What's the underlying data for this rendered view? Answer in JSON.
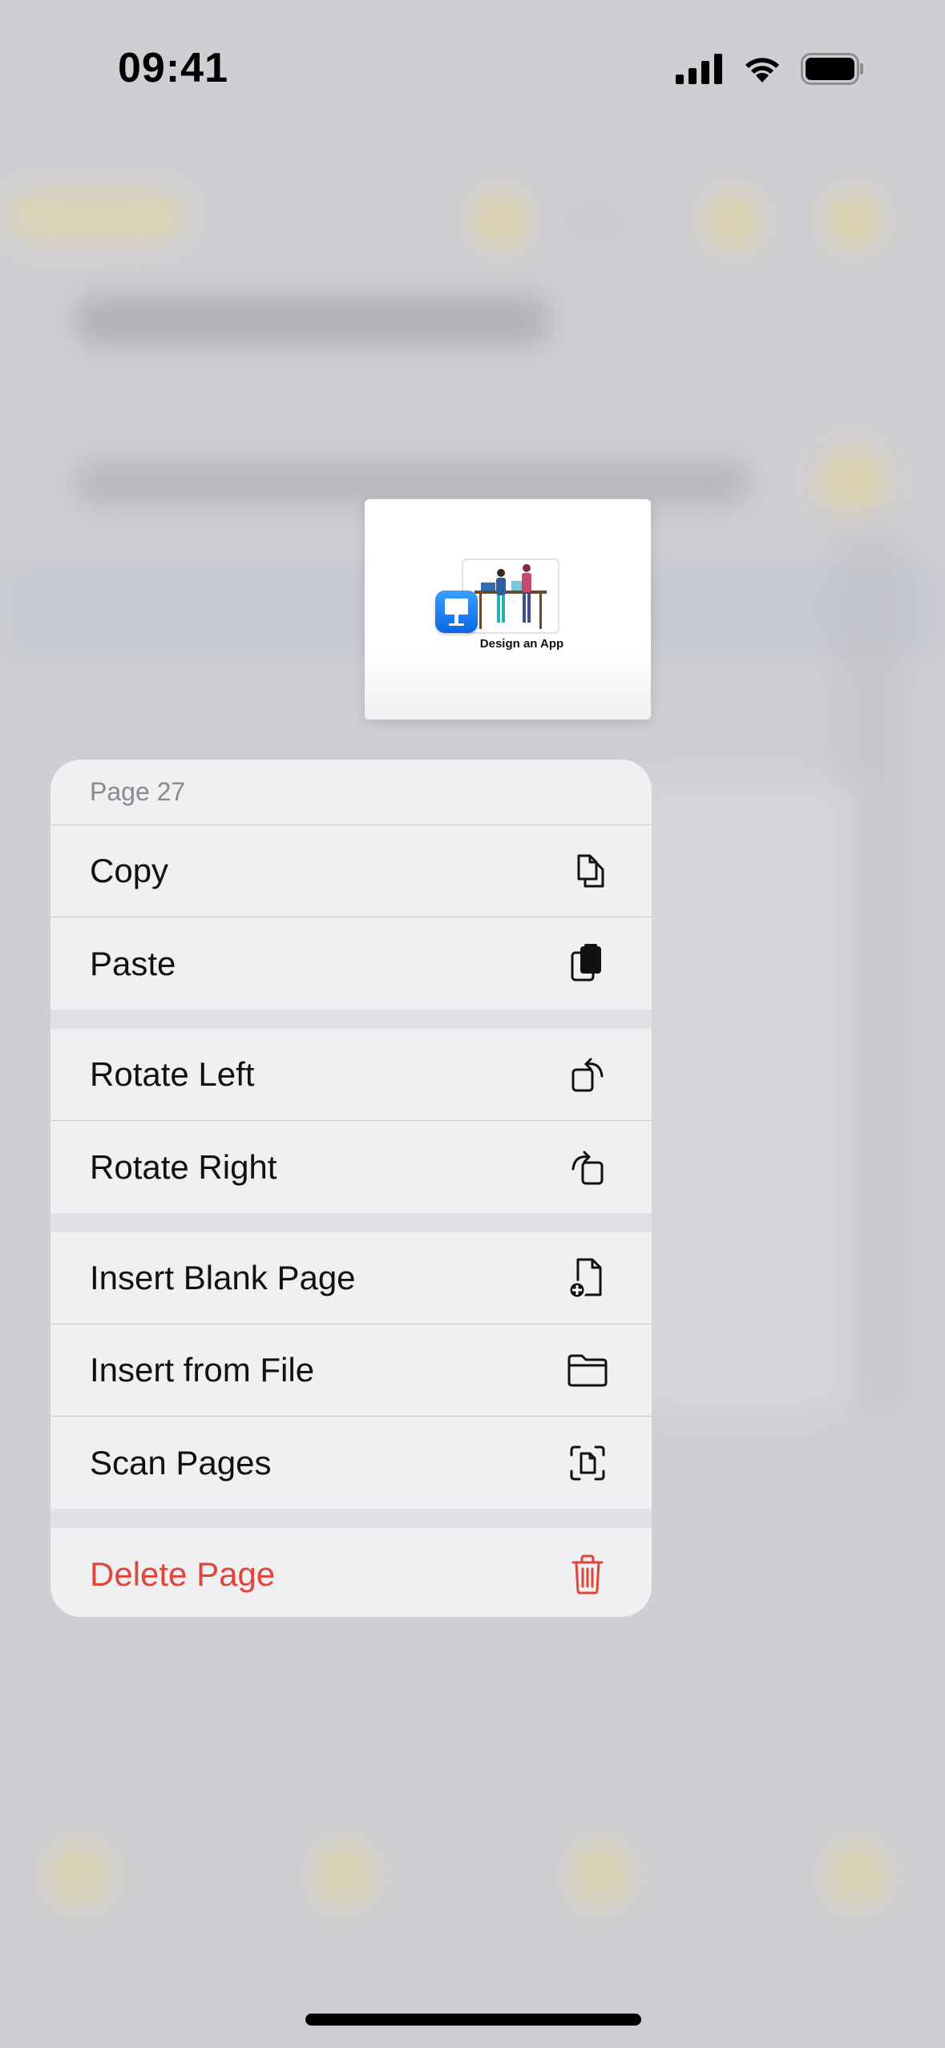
{
  "status_bar": {
    "time": "09:41"
  },
  "preview": {
    "caption": "Design an App"
  },
  "menu": {
    "title": "Page 27",
    "groups": [
      [
        {
          "label": "Copy",
          "icon": "copy-icon"
        },
        {
          "label": "Paste",
          "icon": "paste-icon"
        }
      ],
      [
        {
          "label": "Rotate Left",
          "icon": "rotate-left-icon"
        },
        {
          "label": "Rotate Right",
          "icon": "rotate-right-icon"
        }
      ],
      [
        {
          "label": "Insert Blank Page",
          "icon": "insert-blank-page-icon"
        },
        {
          "label": "Insert from File",
          "icon": "folder-icon"
        },
        {
          "label": "Scan Pages",
          "icon": "scan-icon"
        }
      ],
      [
        {
          "label": "Delete Page",
          "icon": "trash-icon"
        }
      ]
    ]
  },
  "colors": {
    "destructive": "#e0443a",
    "menu_bg": "#f0f0f2",
    "backdrop": "#cfcfd3"
  }
}
